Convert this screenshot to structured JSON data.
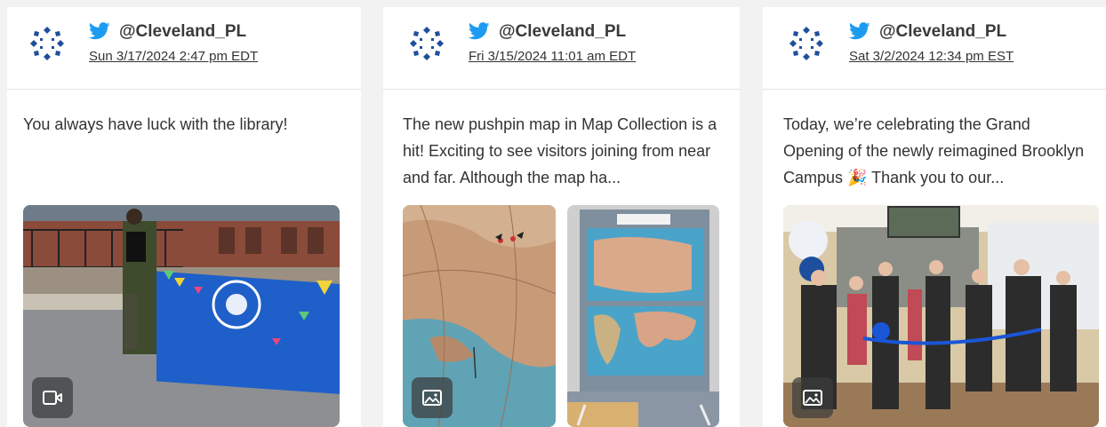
{
  "colors": {
    "twitter_blue": "#1d9bf0",
    "logo_blue": "#1f4f9c"
  },
  "posts": [
    {
      "handle": "@Cleveland_PL",
      "date": "Sun 3/17/2024 2:47 pm EDT",
      "text": "You always have luck with the library!",
      "media_type_icon": "video-icon"
    },
    {
      "handle": "@Cleveland_PL",
      "date": "Fri 3/15/2024 11:01 am EDT",
      "text": "The new pushpin map in Map Collection is a hit! Exciting to see visitors joining from near and far. Although the map ha...",
      "media_type_icon": "image-icon"
    },
    {
      "handle": "@Cleveland_PL",
      "date": "Sat 3/2/2024 12:34 pm EST",
      "text": "Today, we’re celebrating the Grand Opening of the newly reimagined Brooklyn Campus 🎉 Thank you to our...",
      "media_type_icon": "image-icon"
    }
  ]
}
